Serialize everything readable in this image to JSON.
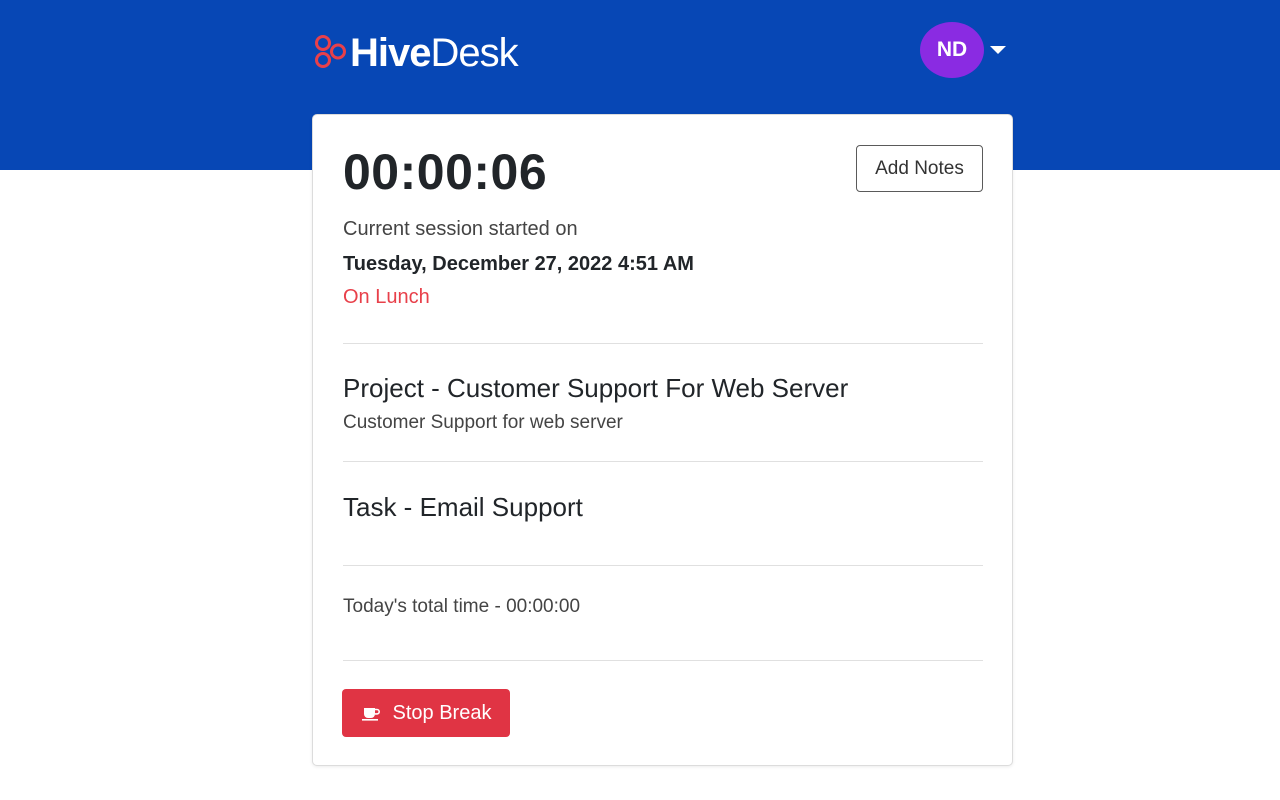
{
  "brand": {
    "logo_bold": "Hive",
    "logo_regular": "Desk",
    "logo_icon": "hivedesk-logo-icon",
    "header_color": "#0747b5",
    "mark_color": "#e8404a"
  },
  "user": {
    "initials": "ND",
    "avatar_color": "#8a2be2",
    "menu_icon": "caret-down-icon"
  },
  "session": {
    "elapsed": "00:00:06",
    "add_notes_label": "Add Notes",
    "started_label": "Current session started on",
    "started_at": "Tuesday, December 27, 2022 4:51 AM",
    "status": "On Lunch",
    "status_color": "#e8404a"
  },
  "project": {
    "title": "Project - Customer Support For Web Server",
    "description": "Customer Support for web server"
  },
  "task": {
    "title": "Task - Email Support"
  },
  "totals": {
    "today": "Today's total time - 00:00:00"
  },
  "actions": {
    "stop_break_label": "Stop Break",
    "stop_break_icon": "coffee-cup-icon",
    "stop_break_color": "#e03444"
  }
}
